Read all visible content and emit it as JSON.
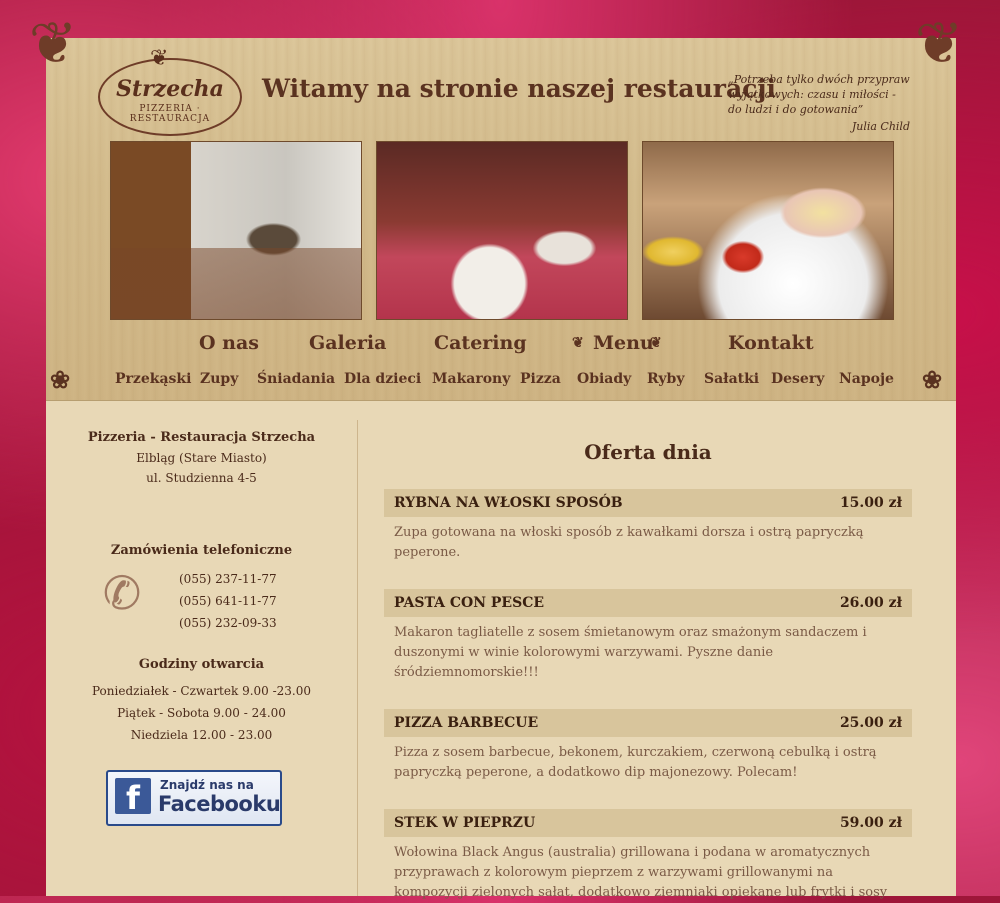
{
  "header": {
    "logo_name": "Strzecha",
    "logo_sub": "PIZZERIA · RESTAURACJA",
    "title": "Witamy na stronie naszej restauracji",
    "quote": "„Potrzeba tylko dwóch przypraw wyjątkowych: czasu i miłości - do ludzi i do gotowania”",
    "quote_author": "Julia Child"
  },
  "main_nav": {
    "items": [
      "O nas",
      "Galeria",
      "Catering",
      "Menu",
      "Kontakt"
    ]
  },
  "sub_nav": {
    "items": [
      "Przekąski",
      "Zupy",
      "Śniadania",
      "Dla dzieci",
      "Makarony",
      "Pizza",
      "Obiady",
      "Ryby",
      "Sałatki",
      "Desery",
      "Napoje"
    ]
  },
  "sidebar": {
    "name": "Pizzeria - Restauracja Strzecha",
    "city": "Elbląg (Stare Miasto)",
    "street": "ul. Studzienna 4-5",
    "phone_heading": "Zamówienia telefoniczne",
    "phones": [
      "(055) 237-11-77",
      "(055) 641-11-77",
      "(055) 232-09-33"
    ],
    "hours_heading": "Godziny otwarcia",
    "hours": [
      "Poniedziałek - Czwartek 9.00 -23.00",
      "Piątek - Sobota 9.00 - 24.00",
      "Niedziela 12.00 - 23.00"
    ],
    "fb_line1": "Znajdź nas na",
    "fb_line2": "Facebooku"
  },
  "content": {
    "heading": "Oferta dnia",
    "offers": [
      {
        "name": "RYBNA NA WŁOSKI SPOSÓB",
        "price": "15.00 zł",
        "desc": "Zupa gotowana na włoski sposób z kawałkami dorsza i ostrą papryczką peperone."
      },
      {
        "name": "PASTA CON PESCE",
        "price": "26.00 zł",
        "desc": "Makaron tagliatelle z sosem śmietanowym oraz smażonym sandaczem i duszonymi w winie kolorowymi warzywami. Pyszne danie śródziemnomorskie!!!"
      },
      {
        "name": "PIZZA BARBECUE",
        "price": "25.00 zł",
        "desc": "Pizza z sosem barbecue, bekonem, kurczakiem, czerwoną cebulką i ostrą papryczką peperone, a dodatkowo dip majonezowy. Polecam!"
      },
      {
        "name": "STEK W PIEPRZU",
        "price": "59.00 zł",
        "desc": "Wołowina Black Angus (australia) grillowana i podana w aromatycznych przyprawach z kolorowym pieprzem z warzywami grillowanymi na kompozycji zielonych sałat, dodatkowo ziemniaki opiekane lub frytki i sosy"
      }
    ]
  }
}
